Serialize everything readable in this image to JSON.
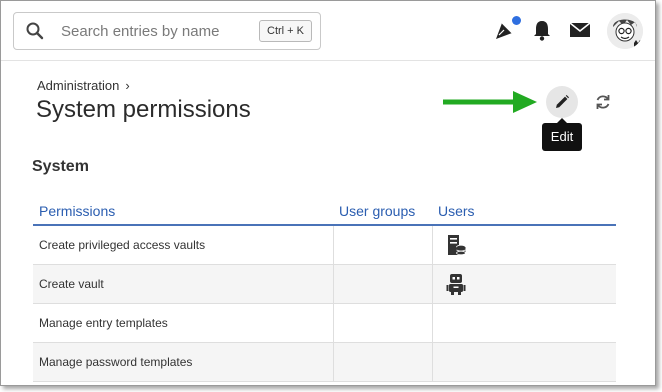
{
  "header": {
    "search_placeholder": "Search entries by name",
    "search_shortcut": "Ctrl + K",
    "icons": [
      "search-icon",
      "announcements-icon",
      "bell-icon",
      "mail-icon"
    ],
    "notification_dot_color": "#2f6fe0"
  },
  "page": {
    "breadcrumb": "Administration",
    "title": "System permissions",
    "edit_tooltip": "Edit",
    "arrow_color": "#22aa22"
  },
  "section": {
    "title": "System",
    "columns": [
      "Permissions",
      "User groups",
      "Users"
    ],
    "rows": [
      {
        "permission": "Create privileged access vaults",
        "user_groups": "",
        "users_icon": "server-user-icon"
      },
      {
        "permission": "Create vault",
        "user_groups": "",
        "users_icon": "robot-user-icon"
      },
      {
        "permission": "Manage entry templates",
        "user_groups": "",
        "users_icon": ""
      },
      {
        "permission": "Manage password templates",
        "user_groups": "",
        "users_icon": ""
      }
    ]
  },
  "colors": {
    "accent": "#2a5db0",
    "header_rule": "#4a73b8",
    "alt_row": "#f5f5f5"
  }
}
